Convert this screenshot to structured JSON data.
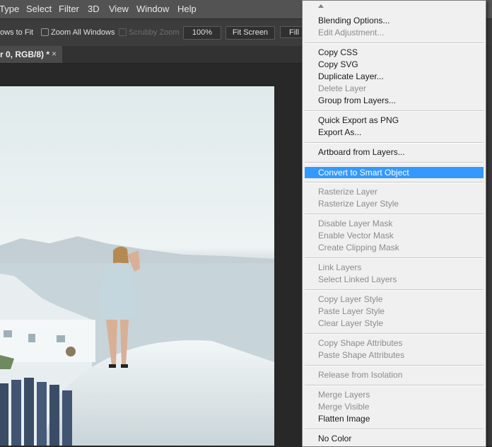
{
  "menubar": {
    "items": [
      "Type",
      "Select",
      "Filter",
      "3D",
      "View",
      "Window",
      "Help"
    ]
  },
  "options": {
    "resize_windows": "ows to Fit",
    "zoom_all_windows": "Zoom All Windows",
    "scrubby_zoom": "Scrubby Zoom",
    "zoom_value": "100%",
    "fit_screen": "Fit Screen",
    "fill_screen": "Fill S"
  },
  "tab": {
    "title": "r 0, RGB/8) *",
    "close": "×"
  },
  "context_menu": {
    "items": [
      {
        "label": "Blending Options...",
        "disabled": false
      },
      {
        "label": "Edit Adjustment...",
        "disabled": true
      },
      {
        "label": "Copy CSS",
        "disabled": false
      },
      {
        "label": "Copy SVG",
        "disabled": false
      },
      {
        "label": "Duplicate Layer...",
        "disabled": false
      },
      {
        "label": "Delete Layer",
        "disabled": true
      },
      {
        "label": "Group from Layers...",
        "disabled": false
      },
      {
        "label": "Quick Export as PNG",
        "disabled": false
      },
      {
        "label": "Export As...",
        "disabled": false
      },
      {
        "label": "Artboard from Layers...",
        "disabled": false
      },
      {
        "label": "Convert to Smart Object",
        "disabled": false,
        "highlighted": true
      },
      {
        "label": "Rasterize Layer",
        "disabled": true
      },
      {
        "label": "Rasterize Layer Style",
        "disabled": true
      },
      {
        "label": "Disable Layer Mask",
        "disabled": true
      },
      {
        "label": "Enable Vector Mask",
        "disabled": true
      },
      {
        "label": "Create Clipping Mask",
        "disabled": true
      },
      {
        "label": "Link Layers",
        "disabled": true
      },
      {
        "label": "Select Linked Layers",
        "disabled": true
      },
      {
        "label": "Copy Layer Style",
        "disabled": true
      },
      {
        "label": "Paste Layer Style",
        "disabled": true
      },
      {
        "label": "Clear Layer Style",
        "disabled": true
      },
      {
        "label": "Copy Shape Attributes",
        "disabled": true
      },
      {
        "label": "Paste Shape Attributes",
        "disabled": true
      },
      {
        "label": "Release from Isolation",
        "disabled": true
      },
      {
        "label": "Merge Layers",
        "disabled": true
      },
      {
        "label": "Merge Visible",
        "disabled": true
      },
      {
        "label": "Flatten Image",
        "disabled": false
      },
      {
        "label": "No Color",
        "disabled": false
      }
    ]
  },
  "colors": {
    "menu_highlight": "#3399ff",
    "menu_background": "#f0f0f0",
    "app_background": "#282828"
  }
}
